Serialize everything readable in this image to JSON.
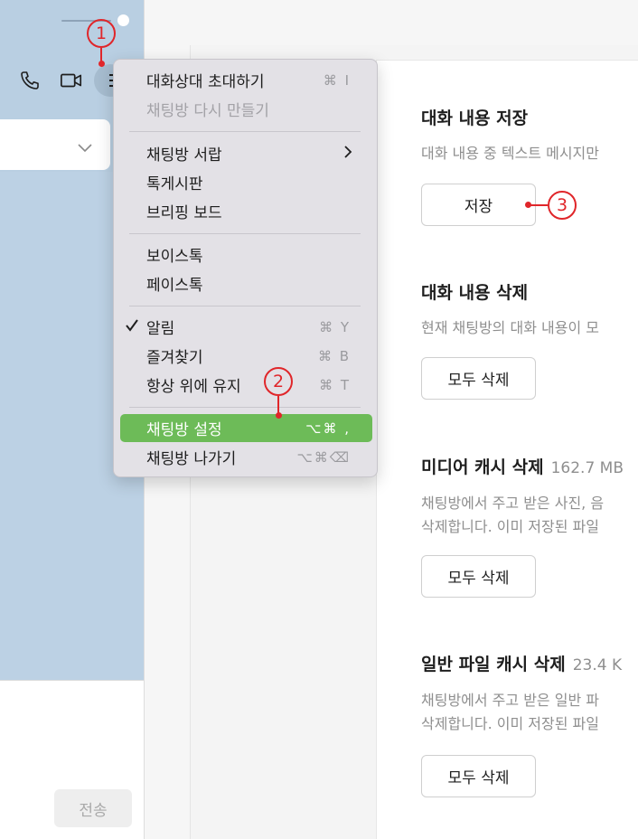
{
  "chat": {
    "send_label": "전송"
  },
  "menu": {
    "items": [
      {
        "label": "대화상대 초대하기",
        "shortcut": "⌘ I",
        "disabled": false
      },
      {
        "label": "채팅방 다시 만들기",
        "shortcut": "",
        "disabled": true
      },
      {
        "label": "채팅방 서랍",
        "shortcut": "",
        "submenu": true
      },
      {
        "label": "톡게시판",
        "shortcut": ""
      },
      {
        "label": "브리핑 보드",
        "shortcut": ""
      },
      {
        "label": "보이스톡",
        "shortcut": ""
      },
      {
        "label": "페이스톡",
        "shortcut": ""
      },
      {
        "label": "알림",
        "shortcut": "⌘ Y",
        "checked": true
      },
      {
        "label": "즐겨찾기",
        "shortcut": "⌘ B"
      },
      {
        "label": "항상 위에 유지",
        "shortcut": "⌘ T"
      },
      {
        "label": "채팅방 설정",
        "shortcut": "⌥⌘ ,",
        "selected": true
      },
      {
        "label": "채팅방 나가기",
        "shortcut": "⌥⌘⌫"
      }
    ]
  },
  "settings": {
    "sections": [
      {
        "title": "대화 내용 저장",
        "size": "",
        "desc_lines": [
          "대화 내용 중 텍스트 메시지만"
        ],
        "button": "저장"
      },
      {
        "title": "대화 내용 삭제",
        "size": "",
        "desc_lines": [
          "현재 채팅방의 대화 내용이 모"
        ],
        "button": "모두 삭제"
      },
      {
        "title": "미디어 캐시 삭제",
        "size": "162.7 MB",
        "desc_lines": [
          "채팅방에서 주고 받은 사진, 음",
          "삭제합니다. 이미 저장된 파일"
        ],
        "button": "모두 삭제"
      },
      {
        "title": "일반 파일 캐시 삭제",
        "size": "23.4 K",
        "desc_lines": [
          "채팅방에서 주고 받은 일반 파",
          "삭제합니다. 이미 저장된 파일"
        ],
        "button": "모두 삭제"
      }
    ]
  },
  "callouts": [
    "1",
    "2",
    "3"
  ],
  "colors": {
    "chat_bg": "#bcd1e4",
    "menu_selected": "#6dbb58",
    "callout": "#e0262a"
  },
  "icons": [
    "phone-icon",
    "video-icon",
    "menu-icon",
    "chevron-down-icon",
    "check-icon",
    "chevron-right-icon"
  ]
}
